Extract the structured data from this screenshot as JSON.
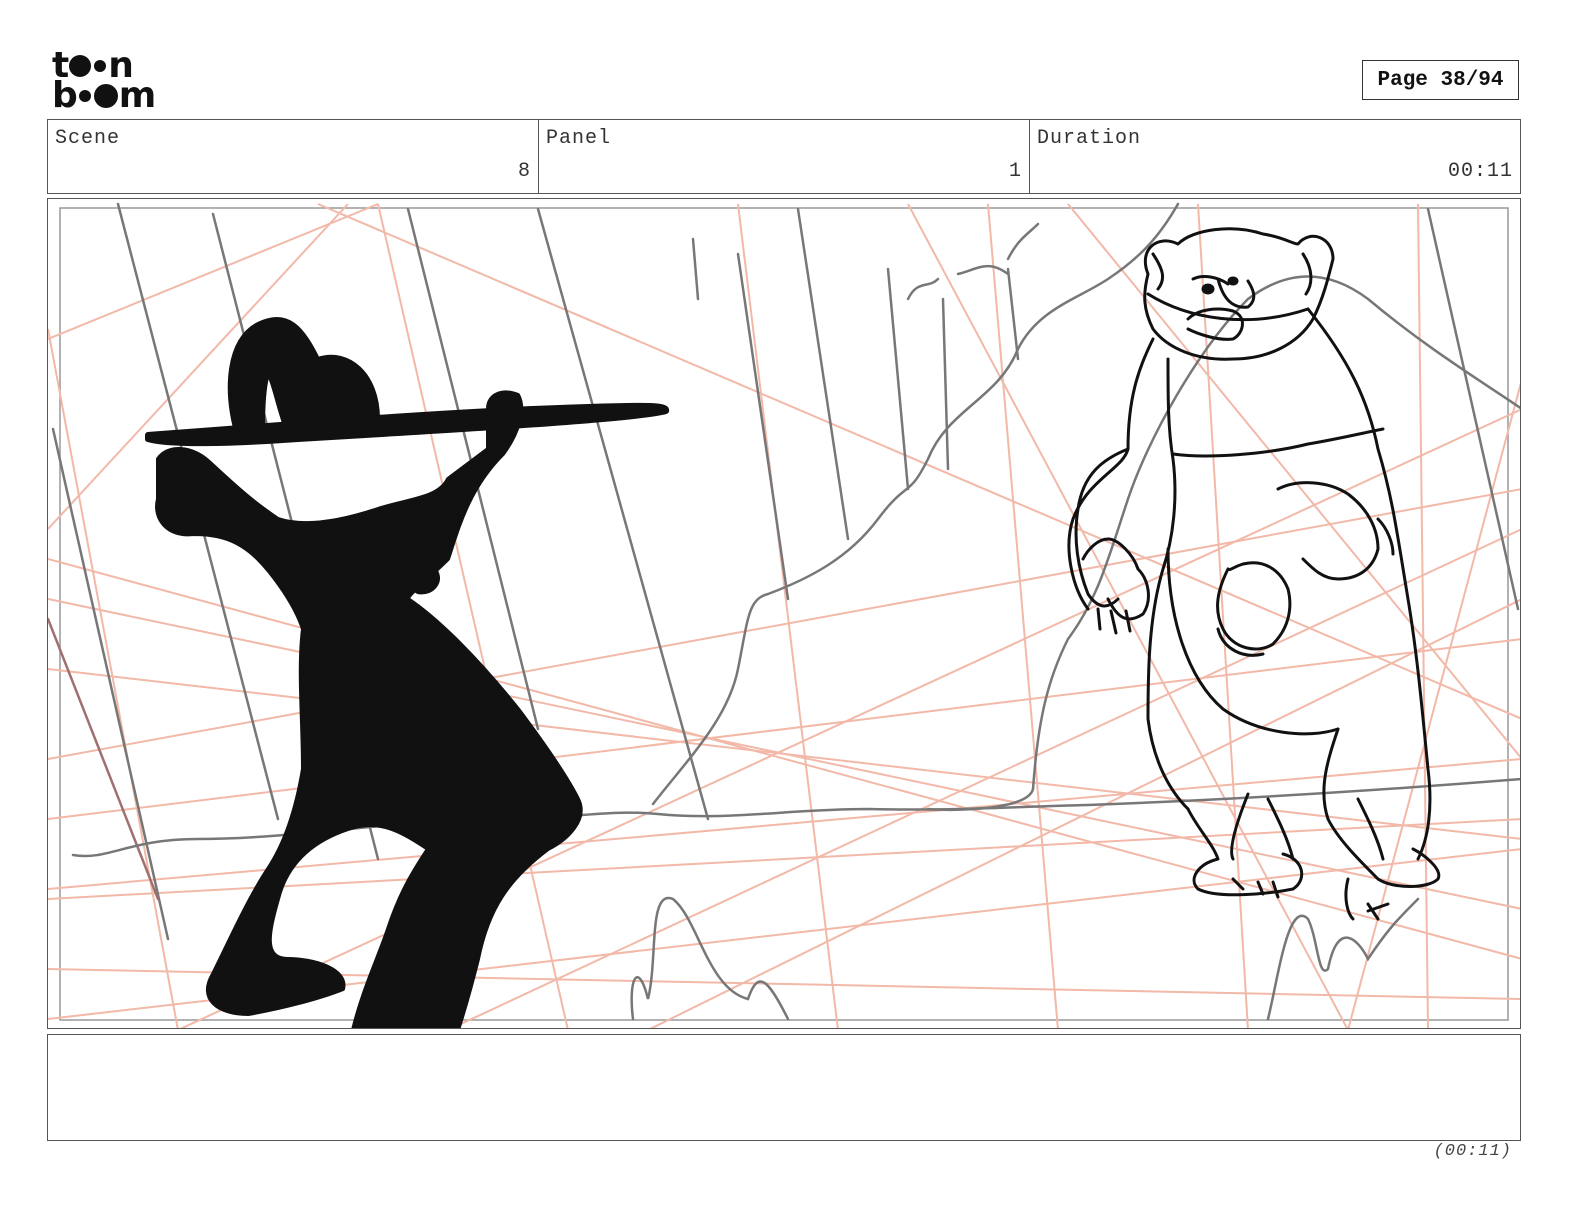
{
  "logo": {
    "row1": [
      "t",
      "n"
    ],
    "row2": [
      "b",
      "m"
    ]
  },
  "page_label": "Page 38/94",
  "header": {
    "scene": {
      "label": "Scene",
      "value": "8"
    },
    "panel": {
      "label": "Panel",
      "value": "1"
    },
    "duration": {
      "label": "Duration",
      "value": "00:11"
    }
  },
  "caption": "",
  "footer_duration": "(00:11)",
  "colors": {
    "guide_lines": "#f2b8a8",
    "sketch_gray": "#777777",
    "ink": "#111111"
  }
}
